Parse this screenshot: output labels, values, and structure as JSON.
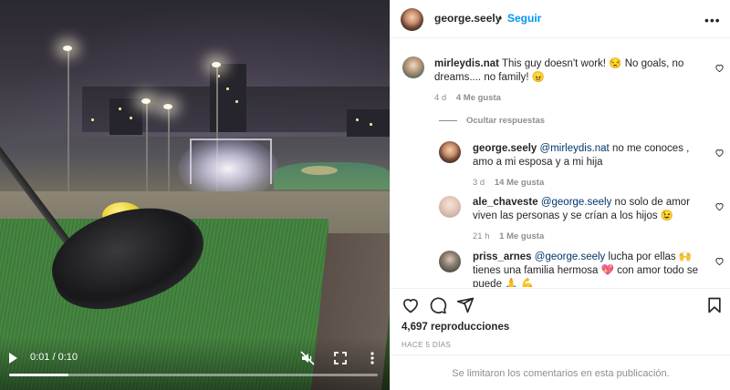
{
  "video": {
    "timecode": "0:01 / 0:10",
    "progress_fraction": 0.16
  },
  "header": {
    "username": "george.seely",
    "separator": "•",
    "follow_label": "Seguir",
    "more_label": "•••"
  },
  "comments": [
    {
      "username": "mirleydis.nat",
      "text": "This guy doesn't work! 😒 No goals, no dreams.... no family! 😠",
      "age": "4 d",
      "likes": "4 Me gusta"
    }
  ],
  "hide_replies_label": "Ocultar respuestas",
  "replies": [
    {
      "username": "george.seely",
      "mention": "@mirleydis.nat",
      "text": " no me conoces , amo a mi esposa y a mi hija",
      "age": "3 d",
      "likes": "14 Me gusta"
    },
    {
      "username": "ale_chaveste",
      "mention": "@george.seely",
      "text": " no solo de amor viven las personas y se crían a los hijos 😉",
      "age": "21 h",
      "likes": "1 Me gusta"
    },
    {
      "username": "priss_arnes",
      "mention": "@george.seely",
      "text": " lucha por ellas 🙌 tienes una familia hermosa 💖 con amor todo se puede 🙏 💪"
    }
  ],
  "views": "4,697 reproducciones",
  "posted": "HACE 5 DÍAS",
  "footer_text": "Se limitaron los comentarios en esta publicación."
}
